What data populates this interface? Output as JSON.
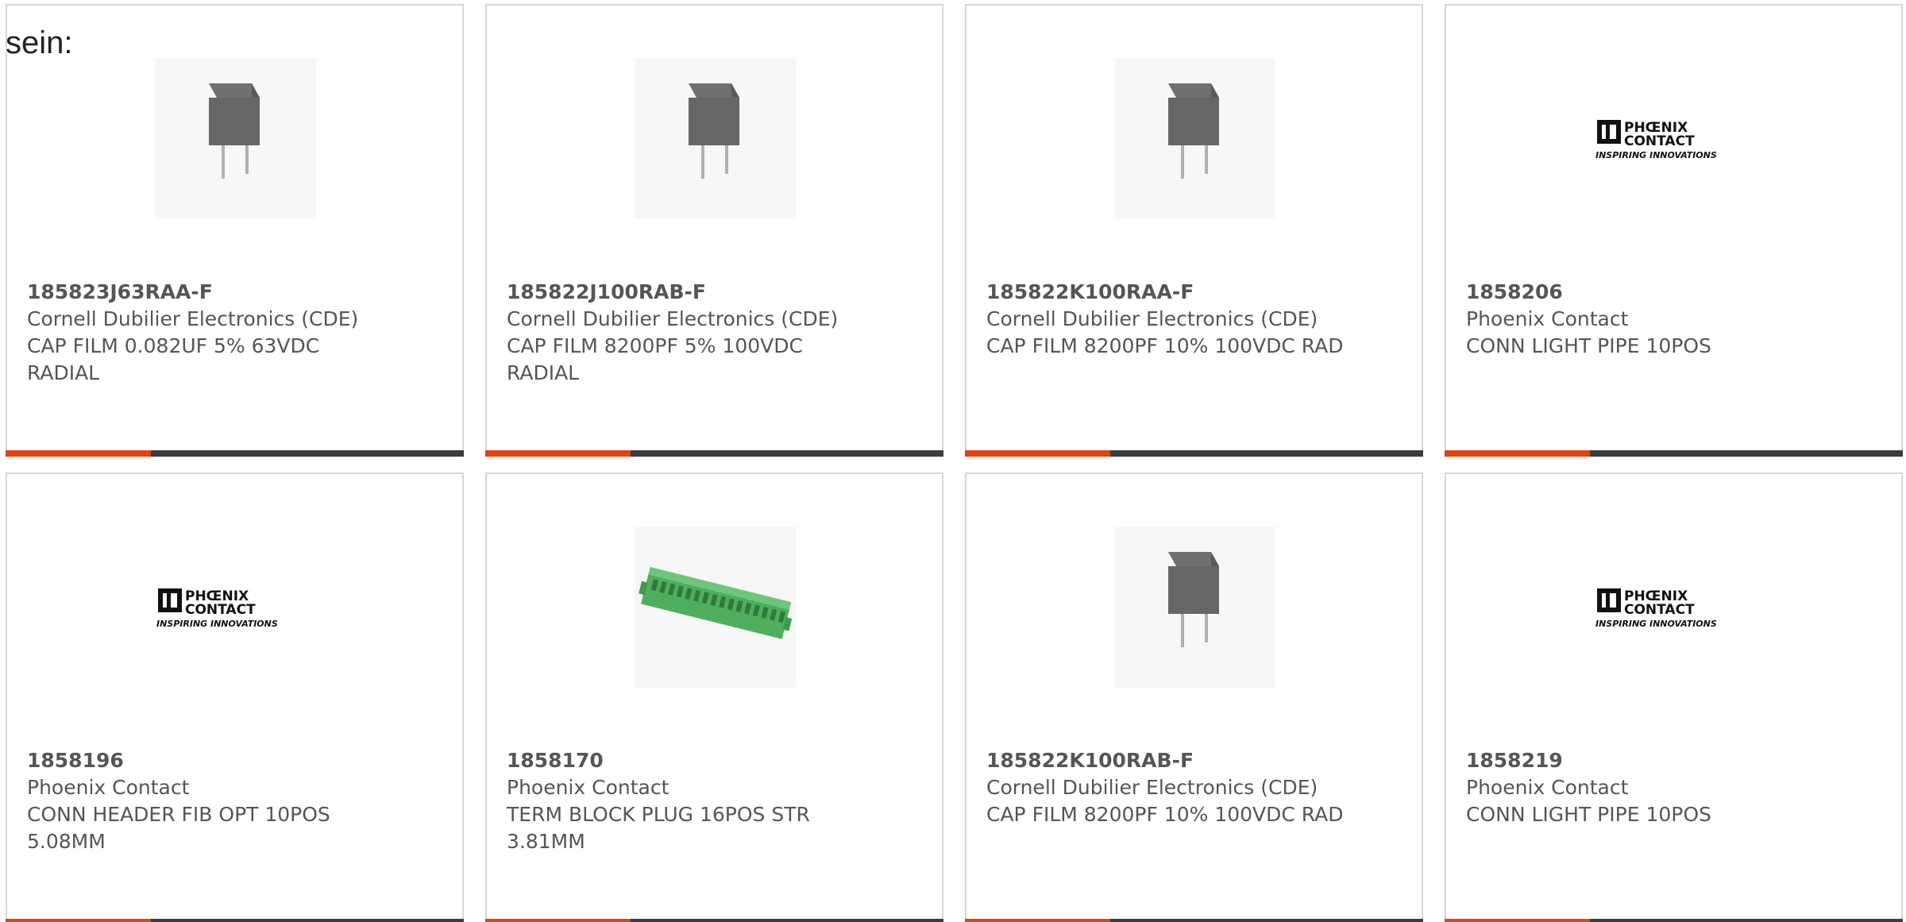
{
  "header": {
    "lead_text": "sein:"
  },
  "colors": {
    "accent": "#e04410",
    "bar_dark": "#3c3c3c",
    "phoenix_green": "#57b866",
    "capacitor_gray": "#555555"
  },
  "products": [
    {
      "part_number": "185823J63RAA-F",
      "manufacturer": "Cornell Dubilier Electronics (CDE)",
      "description": "CAP FILM 0.082UF 5% 63VDC RADIAL",
      "image_type": "capacitor-icon"
    },
    {
      "part_number": "185822J100RAB-F",
      "manufacturer": "Cornell Dubilier Electronics (CDE)",
      "description": "CAP FILM 8200PF 5% 100VDC RADIAL",
      "image_type": "capacitor-icon"
    },
    {
      "part_number": "185822K100RAA-F",
      "manufacturer": "Cornell Dubilier Electronics (CDE)",
      "description": "CAP FILM 8200PF 10% 100VDC RAD",
      "image_type": "capacitor-icon"
    },
    {
      "part_number": "1858206",
      "manufacturer": "Phoenix Contact",
      "description": "CONN LIGHT PIPE 10POS",
      "image_type": "phoenix-logo"
    },
    {
      "part_number": "1858196",
      "manufacturer": "Phoenix Contact",
      "description": "CONN HEADER FIB OPT 10POS 5.08MM",
      "image_type": "phoenix-logo"
    },
    {
      "part_number": "1858170",
      "manufacturer": "Phoenix Contact",
      "description": "TERM BLOCK PLUG 16POS STR 3.81MM",
      "image_type": "terminal-block-icon"
    },
    {
      "part_number": "185822K100RAB-F",
      "manufacturer": "Cornell Dubilier Electronics (CDE)",
      "description": "CAP FILM 8200PF 10% 100VDC RAD",
      "image_type": "capacitor-icon"
    },
    {
      "part_number": "1858219",
      "manufacturer": "Phoenix Contact",
      "description": "CONN LIGHT PIPE 10POS",
      "image_type": "phoenix-logo"
    }
  ],
  "logo_text": {
    "line1": "PHŒNIX",
    "line2": "CONTACT",
    "tagline": "INSPIRING INNOVATIONS"
  }
}
